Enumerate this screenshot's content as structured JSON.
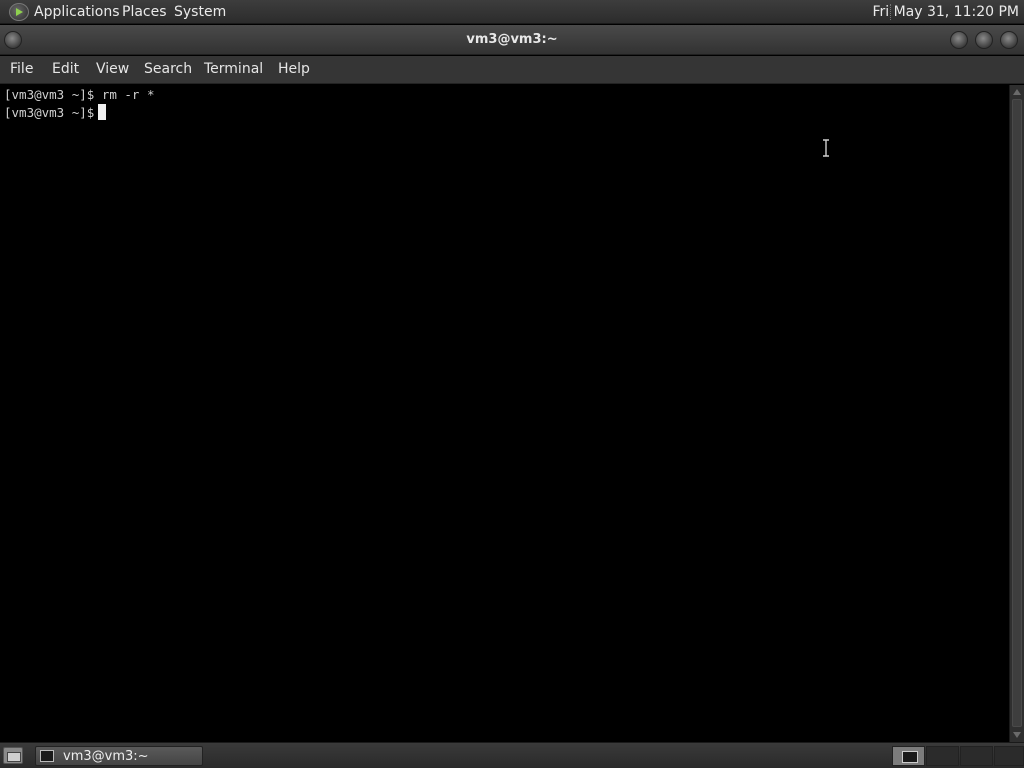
{
  "top_panel": {
    "menus": [
      "Applications",
      "Places",
      "System"
    ],
    "clock": "Fri May 31, 11:20 PM"
  },
  "window": {
    "title": "vm3@vm3:~"
  },
  "menubar": {
    "items": [
      "File",
      "Edit",
      "View",
      "Search",
      "Terminal",
      "Help"
    ]
  },
  "terminal": {
    "lines": [
      "[vm3@vm3 ~]$ rm -r *",
      "[vm3@vm3 ~]$"
    ]
  },
  "taskbar": {
    "task_label": "vm3@vm3:~"
  },
  "colors": {
    "panel": "#2c2c2c",
    "terminal_bg": "#000000",
    "terminal_fg": "#d0d0d0",
    "logo_accent": "#8fd14f"
  },
  "icons": {
    "app_logo": "applications-logo-icon",
    "show_desktop": "show-desktop-icon",
    "task": "terminal-icon"
  }
}
